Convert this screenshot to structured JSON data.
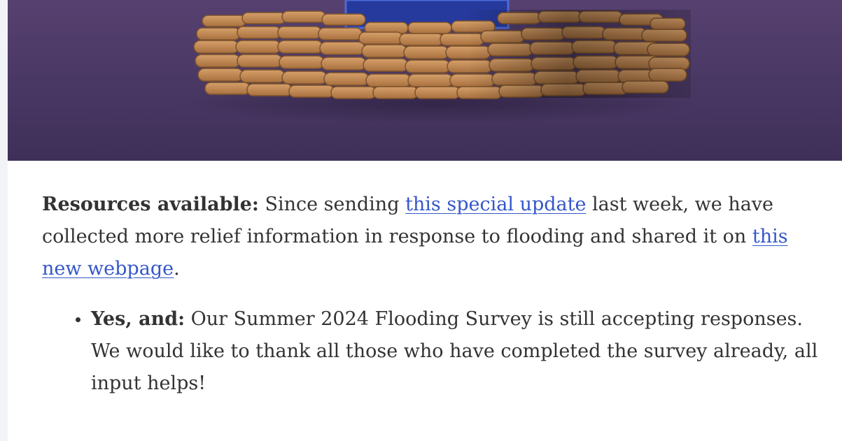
{
  "colors": {
    "hero_bg_top": "#55406f",
    "hero_bg_bottom": "#40315a",
    "sandbag": "#c9925a",
    "sandbag_dark": "#8f6035",
    "blue_panel": "#243a9e",
    "text": "#333333",
    "link": "#3457c9"
  },
  "hero": {
    "image": "sandbag-barrier-illustration"
  },
  "article": {
    "resources": {
      "label": "Resources available:",
      "text_before_link": " Since sending ",
      "link1_text": "this special update",
      "text_between": " last week, we have collected more relief information in response to flooding and shared it on ",
      "link2_text": "this new webpage",
      "text_after": "."
    },
    "bullets": [
      {
        "label": "Yes, and:",
        "text": " Our Summer 2024 Flooding Survey is still accepting responses. We would like to thank all those who have completed the survey already, all input helps!"
      }
    ]
  }
}
